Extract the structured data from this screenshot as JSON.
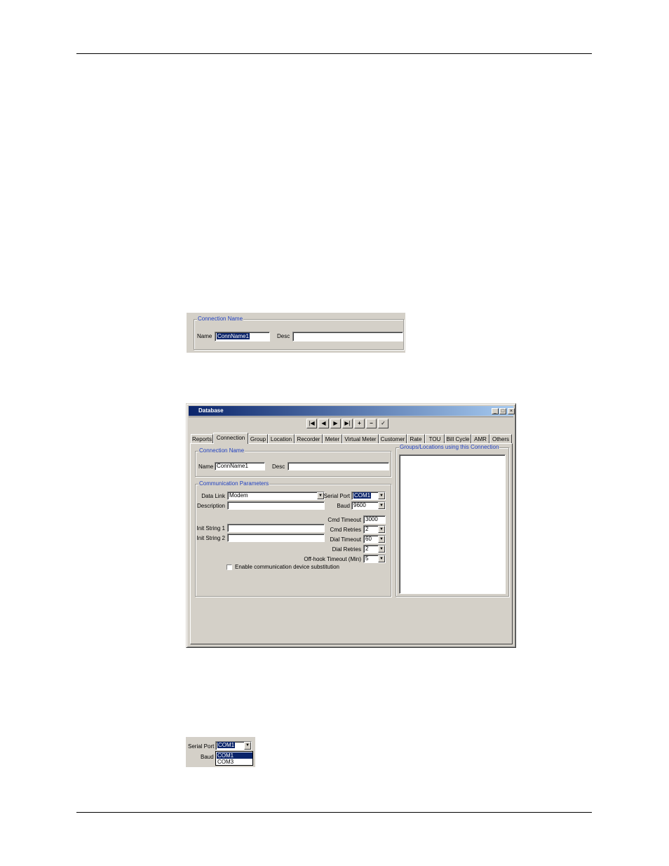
{
  "snippet1": {
    "group_title": "Connection Name",
    "name_label": "Name",
    "name_value": "ConnName1",
    "desc_label": "Desc",
    "desc_value": ""
  },
  "window": {
    "title": "Database",
    "caption_buttons": [
      "_",
      "□",
      "×"
    ],
    "nav_buttons": [
      {
        "icon": "first-record-icon",
        "glyph": "|◀"
      },
      {
        "icon": "previous-record-icon",
        "glyph": "◀"
      },
      {
        "icon": "next-record-icon",
        "glyph": "▶"
      },
      {
        "icon": "last-record-icon",
        "glyph": "▶|"
      },
      {
        "icon": "add-record-icon",
        "glyph": "+"
      },
      {
        "icon": "delete-record-icon",
        "glyph": "−"
      },
      {
        "icon": "post-record-icon",
        "glyph": "✓"
      }
    ],
    "tabs": [
      "Reports",
      "Connection",
      "Group",
      "Location",
      "Recorder",
      "Meter",
      "Virtual Meter",
      "Customer",
      "Rate",
      "TOU",
      "Bill Cycle",
      "AMR",
      "Others"
    ],
    "active_tab": "Connection",
    "connection_name": {
      "group_title": "Connection Name",
      "name_label": "Name",
      "name_value": "ConnName1",
      "desc_label": "Desc",
      "desc_value": ""
    },
    "comm_params": {
      "group_title": "Communication Parameters",
      "data_link_label": "Data Link",
      "data_link_value": "Modem",
      "description_label": "Description",
      "description_value": "",
      "init1_label": "Init String 1",
      "init1_value": "",
      "init2_label": "Init String 2",
      "init2_value": "",
      "serial_port_label": "Serial Port",
      "serial_port_value": "COM1",
      "baud_label": "Baud",
      "baud_value": "9600",
      "cmd_timeout_label": "Cmd Timeout",
      "cmd_timeout_value": "3000",
      "cmd_retries_label": "Cmd Retries",
      "cmd_retries_value": "2",
      "dial_timeout_label": "Dial Timeout",
      "dial_timeout_value": "60",
      "dial_retries_label": "Dial Retries",
      "dial_retries_value": "2",
      "offhook_label": "Off-hook Timeout (Min)",
      "offhook_value": "5",
      "substitution_label": "Enable communication device substitution",
      "substitution_checked": false
    },
    "groups_locations": {
      "group_title": "Groups/Locations using this Connection",
      "items": []
    }
  },
  "snippet3": {
    "serial_port_label": "Serial Port",
    "serial_port_value": "COM1",
    "baud_label": "Baud",
    "options": [
      "COM1",
      "COM3"
    ],
    "highlighted_option": "COM1"
  }
}
